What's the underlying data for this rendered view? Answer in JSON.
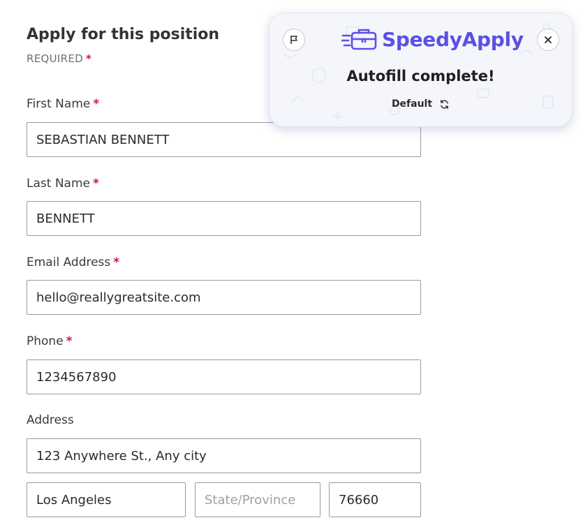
{
  "form": {
    "title": "Apply for this position",
    "required_note": "REQUIRED",
    "required_marker": "*",
    "fields": {
      "first_name": {
        "label": "First Name",
        "value": "SEBASTIAN BENNETT"
      },
      "last_name": {
        "label": "Last Name",
        "value": "BENNETT"
      },
      "email": {
        "label": "Email Address",
        "value": "hello@reallygreatsite.com"
      },
      "phone": {
        "label": "Phone",
        "value": "1234567890"
      },
      "address": {
        "label": "Address",
        "street": "123 Anywhere St., Any city",
        "city": "Los Angeles",
        "state_placeholder": "State/Province",
        "state": "",
        "zip": "76660"
      }
    }
  },
  "popup": {
    "brand": "SpeedyApply",
    "headline": "Autofill complete!",
    "profile": "Default",
    "icons": {
      "flag": "flag-icon",
      "close": "close-icon",
      "refresh": "refresh-icon",
      "logo": "briefcase-logo-icon"
    }
  },
  "colors": {
    "required_star": "#c2185b",
    "brand": "#5b4fe6",
    "input_border": "#9a9a9a"
  }
}
